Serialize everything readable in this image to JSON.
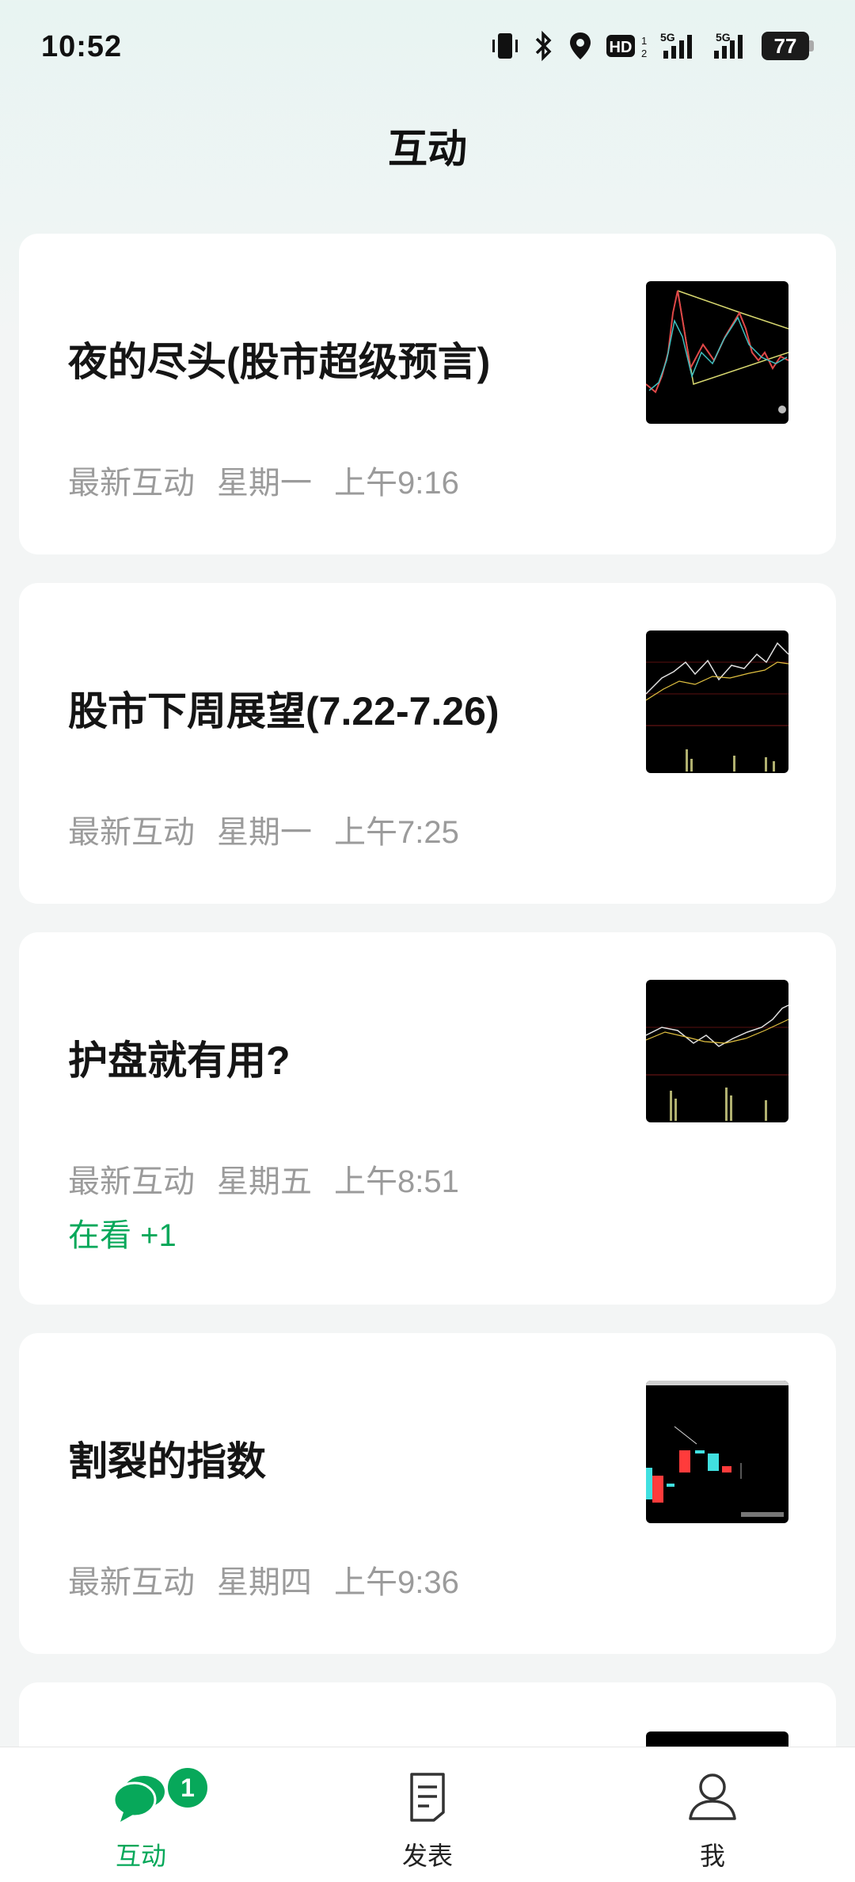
{
  "status_bar": {
    "time": "10:52",
    "battery": "77",
    "hd_label": "HD"
  },
  "header": {
    "title": "互动"
  },
  "articles": [
    {
      "title": "夜的尽头(股市超级预言)",
      "meta_label": "最新互动",
      "day": "星期一",
      "time": "上午9:16",
      "watching": ""
    },
    {
      "title": "股市下周展望(7.22-7.26)",
      "meta_label": "最新互动",
      "day": "星期一",
      "time": "上午7:25",
      "watching": ""
    },
    {
      "title": "护盘就有用?",
      "meta_label": "最新互动",
      "day": "星期五",
      "time": "上午8:51",
      "watching": "在看 +1"
    },
    {
      "title": "割裂的指数",
      "meta_label": "最新互动",
      "day": "星期四",
      "time": "上午9:36",
      "watching": ""
    }
  ],
  "bottom_nav": {
    "items": [
      {
        "label": "互动",
        "icon": "chat-bubbles-icon",
        "badge": "1",
        "active": true
      },
      {
        "label": "发表",
        "icon": "document-icon"
      },
      {
        "label": "我",
        "icon": "person-icon"
      }
    ]
  },
  "colors": {
    "accent": "#07a85a",
    "meta_gray": "#9b9b9b",
    "card_bg": "#ffffff",
    "page_bg": "#f3f5f5"
  }
}
